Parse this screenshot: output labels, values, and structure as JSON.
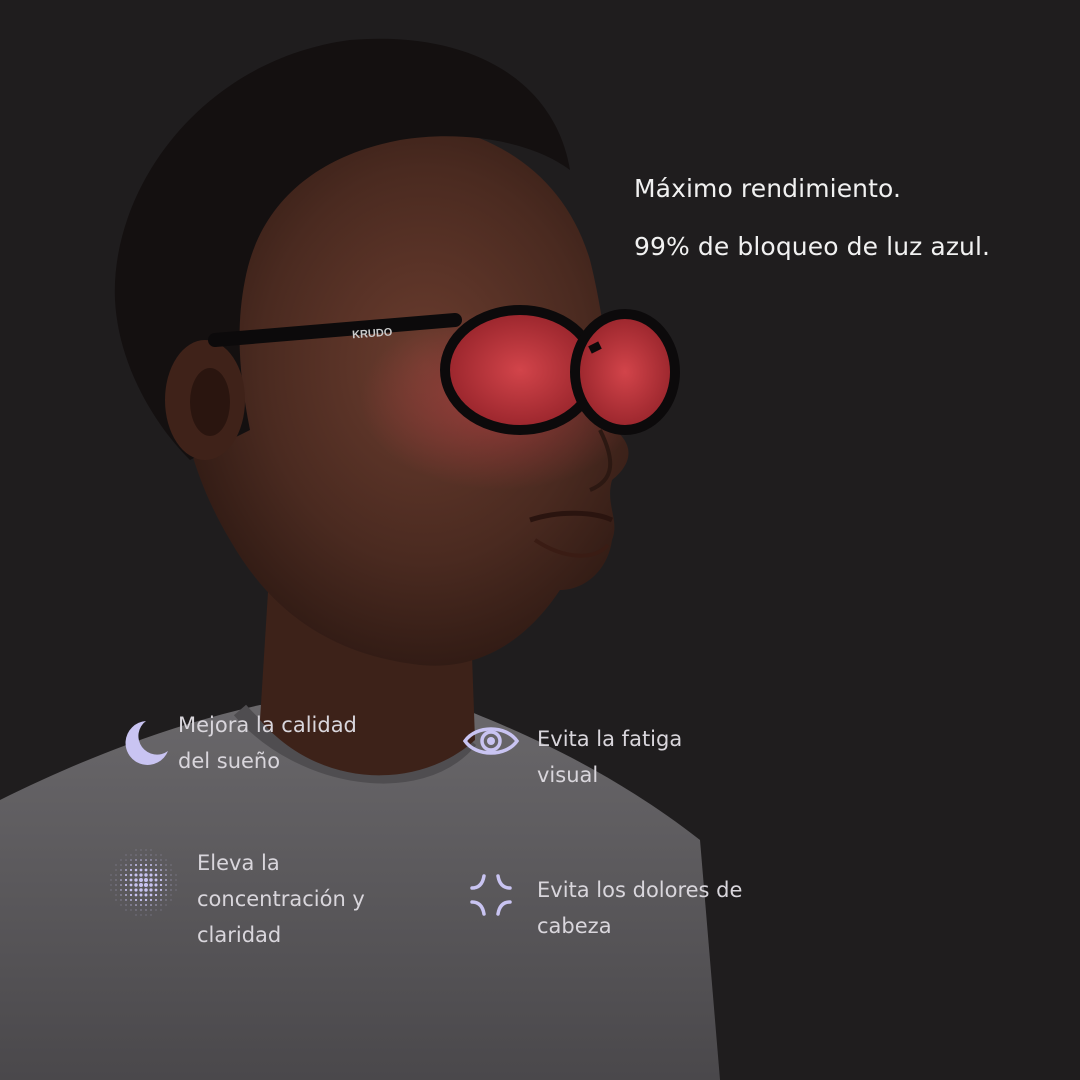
{
  "headline": {
    "line1": "Máximo rendimiento.",
    "line2": "99% de bloqueo de luz azul."
  },
  "frame_brand": "KRUDO",
  "features": {
    "sleep": {
      "icon": "moon-icon",
      "text": "Mejora la calidad\ndel sueño"
    },
    "eye": {
      "icon": "eye-icon",
      "text": "Evita la fatiga\nvisual"
    },
    "focus": {
      "icon": "dot-halftone-icon",
      "text": "Eleva la\nconcentración y\nclaridad"
    },
    "headache": {
      "icon": "ache-burst-icon",
      "text": "Evita los dolores de\ncabeza"
    }
  },
  "colors": {
    "background": "#1f1d1e",
    "icon_lavender": "#c9c4f2",
    "lens_red": "#b8353a",
    "shirt_grey": "#5b595c",
    "skin": "#4a2a20"
  }
}
